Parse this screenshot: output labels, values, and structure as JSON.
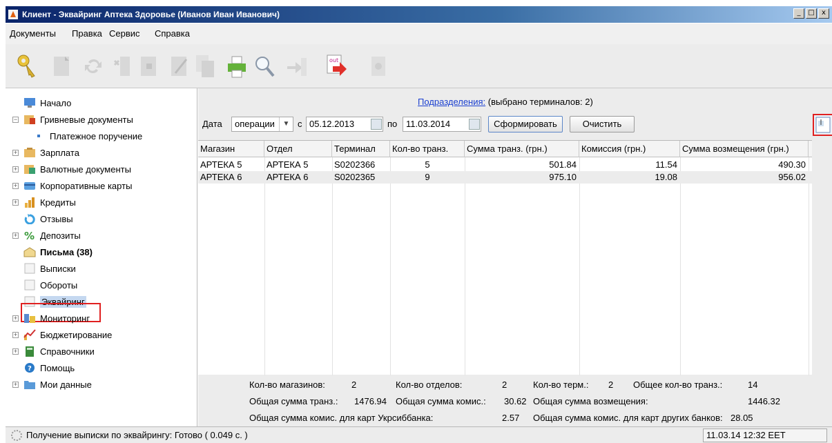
{
  "window": {
    "title": "Клиент - Эквайринг Аптека Здоровье (Иванов Иван Иванович)",
    "min_btn": "_",
    "max_btn": "□",
    "close_btn": "x"
  },
  "menu": [
    "Документы",
    "Правка",
    "Сервис",
    "Справка"
  ],
  "toolbar": {
    "icons": [
      "key-icon",
      "document-icon",
      "refresh-icon",
      "delete-icon",
      "sign-icon",
      "edit-icon",
      "copy-icon",
      "print-icon",
      "search-icon",
      "import-icon",
      "export-out-icon",
      "send-icon"
    ],
    "out_label": "out"
  },
  "sidebar": {
    "items": [
      {
        "label": "Начало",
        "icon": "monitor-icon"
      },
      {
        "label": "Гривневые документы",
        "icon": "hryvnia-docs-icon"
      },
      {
        "label": "Платежное поручение",
        "icon": "bullet-icon"
      },
      {
        "label": "Зарплата",
        "icon": "salary-icon"
      },
      {
        "label": "Валютные документы",
        "icon": "currency-docs-icon"
      },
      {
        "label": "Корпоративные карты",
        "icon": "card-icon"
      },
      {
        "label": "Кредиты",
        "icon": "credits-icon"
      },
      {
        "label": "Отзывы",
        "icon": "recall-icon"
      },
      {
        "label": "Депозиты",
        "icon": "percent-icon"
      },
      {
        "label": "Письма (38)",
        "icon": "mail-icon"
      },
      {
        "label": "Выписки",
        "icon": "page-icon"
      },
      {
        "label": "Обороты",
        "icon": "page-icon"
      },
      {
        "label": "Эквайринг",
        "icon": "page-icon"
      },
      {
        "label": "Мониторинг",
        "icon": "monitoring-icon"
      },
      {
        "label": "Бюджетирование",
        "icon": "budget-icon"
      },
      {
        "label": "Справочники",
        "icon": "book-icon"
      },
      {
        "label": "Помощь",
        "icon": "help-icon"
      },
      {
        "label": "Мои данные",
        "icon": "folder-icon"
      }
    ]
  },
  "main": {
    "subdivisions_link": "Подразделения:",
    "subdivisions_note": "(выбрано терминалов: 2)",
    "filter": {
      "date_label": "Дата",
      "date_type": "операции",
      "from_label": "с",
      "from_date": "05.12.2013",
      "to_label": "по",
      "to_date": "11.03.2014",
      "generate_btn": "Сформировать",
      "clear_btn": "Очистить"
    },
    "table": {
      "columns": [
        "Магазин",
        "Отдел",
        "Терминал",
        "Кол-во транз.",
        "Сумма транз. (грн.)",
        "Комиссия (грн.)",
        "Сумма возмещения (грн.)"
      ],
      "rows": [
        [
          "АРТЕКА 5",
          "АРТЕКА 5",
          "S0202366",
          "5",
          "501.84",
          "11.54",
          "490.30"
        ],
        [
          "АРТЕКА 6",
          "АРТЕКА 6",
          "S0202365",
          "9",
          "975.10",
          "19.08",
          "956.02"
        ]
      ]
    },
    "summary": {
      "shops_label": "Кол-во магазинов:",
      "shops_value": "2",
      "depts_label": "Кол-во отделов:",
      "depts_value": "2",
      "terms_label": "Кол-во терм.:",
      "terms_value": "2",
      "tx_count_label": "Общее кол-во транз.:",
      "tx_count_value": "14",
      "tx_sum_label": "Общая сумма транз.:",
      "tx_sum_value": "1476.94",
      "fee_sum_label": "Общая сумма комис.:",
      "fee_sum_value": "30.62",
      "refund_label": "Общая сумма возмещения:",
      "refund_value": "1446.32",
      "fee_ukrsib_label": "Общая сумма комис. для карт Укрсиббанка:",
      "fee_ukrsib_value": "2.57",
      "fee_other_label": "Общая сумма комис. для карт других банков:",
      "fee_other_value": "28.05"
    }
  },
  "status": {
    "text": "Получение выписки по эквайрингу: Готово ( 0.049 с. )",
    "datetime": "11.03.14 12:32 EET"
  }
}
